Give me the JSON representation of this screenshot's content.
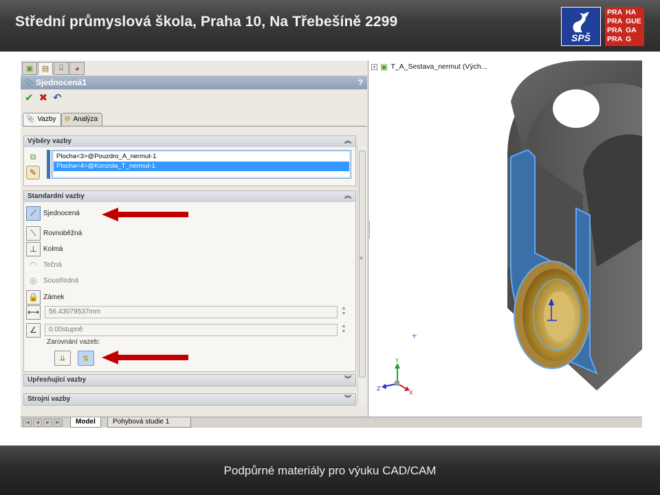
{
  "header": {
    "title": "Střední průmyslová škola, Praha 10, Na Třebešíně 2299"
  },
  "logos": {
    "sps_text": "SPŠ",
    "praha_rows": [
      [
        "PRA",
        "HA"
      ],
      [
        "PRA",
        "GUE"
      ],
      [
        "PRA",
        "GA"
      ],
      [
        "PRA",
        "G"
      ]
    ]
  },
  "property_manager": {
    "title": "Sjednocená1",
    "help": "?",
    "actions": {
      "ok": "✔",
      "cancel": "✖",
      "undo": "↶"
    },
    "subtabs": [
      {
        "label": "Vazby"
      },
      {
        "label": "Analýza"
      }
    ],
    "groups": {
      "mate_selections": {
        "title": "Výběry vazby",
        "items": [
          "Plocha<3>@Pouzdro_A_nermut-1",
          "Plocha<4>@Konzola_T_nermut-1"
        ],
        "selected_index": 1
      },
      "standard_mates": {
        "title": "Standardní vazby",
        "mates": [
          {
            "label": "Sjednocená",
            "state": "active"
          },
          {
            "label": "Rovnoběžná",
            "state": "enabled"
          },
          {
            "label": "Kolmá",
            "state": "enabled"
          },
          {
            "label": "Tečná",
            "state": "disabled"
          },
          {
            "label": "Soustředná",
            "state": "disabled"
          },
          {
            "label": "Zámek",
            "state": "enabled"
          }
        ],
        "distance_value": "56.43079537mm",
        "angle_value": "0.00stupně",
        "alignment_label": "Zarovnání vazeb:"
      },
      "advanced_mates": {
        "title": "Upřesňující vazby"
      },
      "mechanical_mates": {
        "title": "Strojní vazby"
      }
    }
  },
  "tree": {
    "root_label": "T_A_Sestava_nermut  (Vých..."
  },
  "bottom_tabs": [
    "Model",
    "Pohybová studie 1"
  ],
  "triad": {
    "x": "X",
    "y": "Y",
    "z": "Z"
  },
  "footer": {
    "text": "Podpůrné materiály pro výuku CAD/CAM"
  },
  "colors": {
    "arrow": "#c00000",
    "selection": "#3399ff",
    "part_gray": "#5a5a58",
    "bushing_gold": "#b8952f"
  }
}
